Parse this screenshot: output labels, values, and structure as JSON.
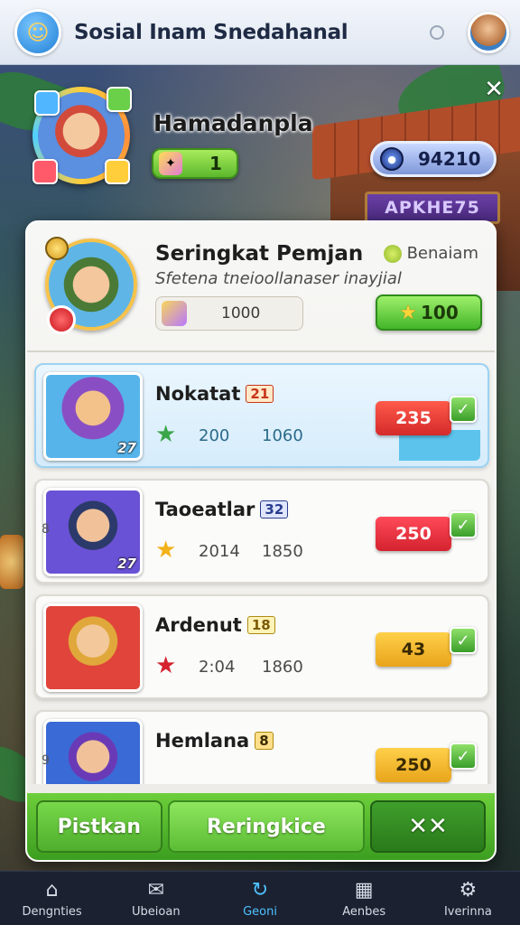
{
  "app": {
    "title": "Sosial Inam Snedahanal",
    "logo_icon": "smiley-face-icon",
    "avatar_icon": "profile-avatar-icon"
  },
  "player": {
    "name": "Hamadanpla",
    "level": "1",
    "coins": "94210",
    "sign_text": "APKHE75"
  },
  "panel": {
    "title": "Seringkat Pemjan",
    "tag": "Benaiam",
    "subtitle": "Sfetena tneioollanaser inayjial",
    "score": "1000",
    "reward": "100"
  },
  "rows": [
    {
      "name": "Nokatat",
      "badge": "21",
      "card_num": "27",
      "v1": "200",
      "v2": "1060",
      "action": "235",
      "side_num": ""
    },
    {
      "name": "Taoeatlar",
      "badge": "32",
      "card_num": "27",
      "v1": "2014",
      "v2": "1850",
      "action": "250",
      "side_num": "8"
    },
    {
      "name": "Ardenut",
      "badge": "18",
      "card_num": "",
      "v1": "2:04",
      "v2": "1860",
      "action": "43",
      "side_num": ""
    },
    {
      "name": "Hemlana",
      "badge": "8",
      "card_num": "",
      "v1": "",
      "v2": "",
      "action": "250",
      "side_num": "9"
    }
  ],
  "actions": {
    "left": "Pistkan",
    "middle": "Reringkice",
    "right": "✕✕"
  },
  "nav": [
    {
      "label": "Dengnties",
      "icon": "home-icon"
    },
    {
      "label": "Ubeioan",
      "icon": "inbox-icon"
    },
    {
      "label": "Geoni",
      "icon": "refresh-icon"
    },
    {
      "label": "Aenbes",
      "icon": "calendar-icon"
    },
    {
      "label": "Iverinna",
      "icon": "gear-icon"
    }
  ],
  "colors": {
    "accent_green": "#5cb82c",
    "action_red": "#e8343a",
    "action_yellow": "#f2b92a",
    "nav_active": "#4fc1ff"
  }
}
